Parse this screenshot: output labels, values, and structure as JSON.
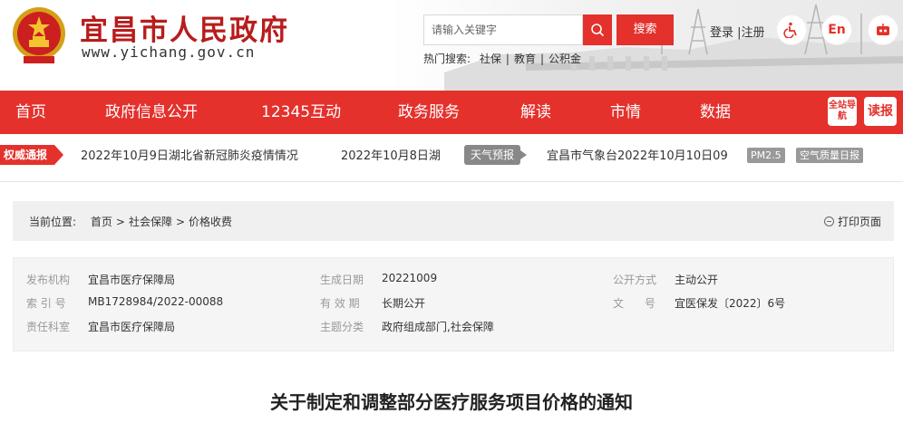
{
  "header": {
    "site_title": "宜昌市人民政府",
    "site_url": "www.yichang.gov.cn",
    "search_placeholder": "请输入关键字",
    "search_button": "搜索",
    "hot_label": "热门搜索:",
    "hot_items": [
      "社保",
      "教育",
      "公积金"
    ],
    "login": "登录",
    "register": "注册",
    "lang_en": "En"
  },
  "nav": {
    "items": [
      "首页",
      "政府信息公开",
      "12345互动",
      "政务服务",
      "解读",
      "市情",
      "数据"
    ],
    "site_nav_badge": "全站导航",
    "read_badge": "读报"
  },
  "ticker": {
    "tag": "权威通报",
    "news1": "2022年10月9日湖北省新冠肺炎疫情情况",
    "news2": "2022年10月8日湖",
    "weather_tag": "天气预报",
    "weather_text": "宜昌市气象台2022年10月10日09",
    "pm_tag": "PM2.5",
    "aq_tag": "空气质量日报"
  },
  "breadcrumb": {
    "prefix": "当前位置:",
    "items": [
      "首页",
      "社会保障",
      "价格收费"
    ],
    "print": "打印页面"
  },
  "meta": {
    "rows": [
      [
        {
          "label": "发布机构",
          "value": "宜昌市医疗保障局"
        },
        {
          "label": "生成日期",
          "value": "20221009"
        },
        {
          "label": "公开方式",
          "value": "主动公开"
        }
      ],
      [
        {
          "label": "索 引 号",
          "value": "MB1728984/2022-00088"
        },
        {
          "label": "有 效 期",
          "value": "长期公开"
        },
        {
          "label": "文      号",
          "value": "宜医保发〔2022〕6号"
        }
      ],
      [
        {
          "label": "责任科室",
          "value": "宜昌市医疗保障局"
        },
        {
          "label": "主题分类",
          "value": "政府组成部门,社会保障"
        },
        {
          "label": "",
          "value": ""
        }
      ]
    ]
  },
  "document": {
    "title": "关于制定和调整部分医疗服务项目价格的通知"
  },
  "colors": {
    "brand_red": "#e4312c",
    "title_red": "#b81c1c",
    "panel_gray": "#f0f0f0"
  }
}
